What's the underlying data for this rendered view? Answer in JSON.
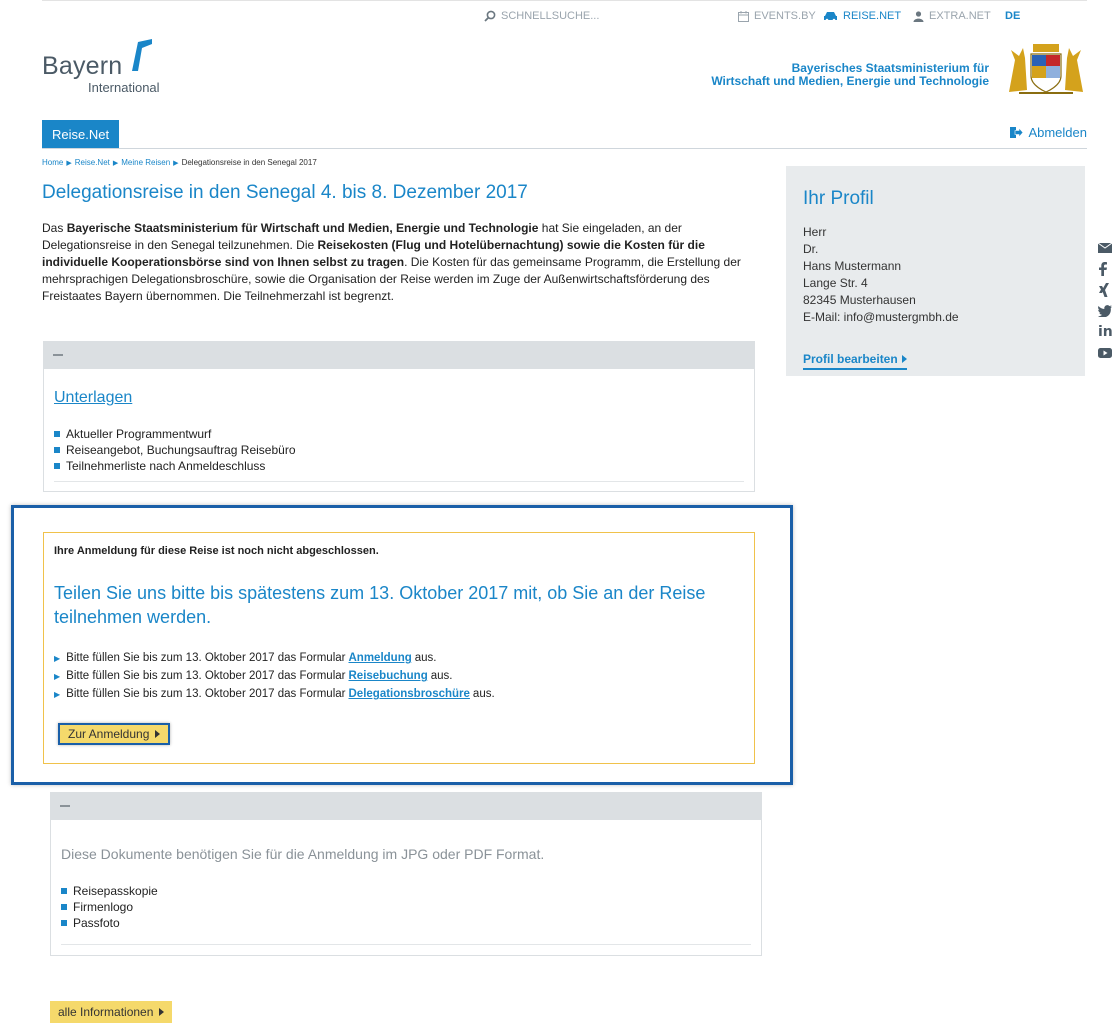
{
  "util": {
    "search_placeholder": "SCHNELLSUCHE...",
    "events": "EVENTS.BY",
    "reise": "REISE.NET",
    "extra": "EXTRA.NET",
    "lang": "DE"
  },
  "logo": {
    "line1": "Bayern",
    "line2": "International"
  },
  "ministry": {
    "line1": "Bayerisches Staatsministerium für",
    "line2": "Wirtschaft und Medien, Energie und Technologie"
  },
  "nav": {
    "tab": "Reise.Net",
    "logout": "Abmelden"
  },
  "breadcrumb": [
    "Home",
    "Reise.Net",
    "Meine Reisen",
    "Delegationsreise in den Senegal 2017"
  ],
  "page": {
    "title": "Delegationsreise in den Senegal 4. bis 8. Dezember 2017",
    "intro": {
      "p1": "Das ",
      "b1": "Bayerische Staatsministerium für Wirtschaft und Medien, Energie und Technologie",
      "p2": " hat Sie eingeladen, an der Delegationsreise in den Senegal teilzunehmen. Die ",
      "b2": "Reisekosten (Flug und Hotelübernachtung) sowie die Kosten für die individuelle Kooperationsbörse sind von Ihnen selbst zu tragen",
      "p3": ". Die Kosten für das gemeinsame Programm, die Erstellung der mehrsprachigen Delegationsbroschüre, sowie die Organisation der Reise werden im Zuge der Außenwirtschaftsförderung des Freistaates Bayern übernommen. Die Teilnehmerzahl ist begrenzt."
    }
  },
  "unterlagen": {
    "title": "Unterlagen",
    "items": [
      "Aktueller Programmentwurf",
      "Reiseangebot, Buchungsauftrag Reisebüro",
      "Teilnehmerliste nach Anmeldeschluss"
    ]
  },
  "registration": {
    "notice": "Ihre Anmeldung für diese Reise ist noch nicht abgeschlossen.",
    "headline": "Teilen Sie uns bitte bis spätestens zum 13. Oktober 2017 mit, ob Sie an der Reise teilnehmen werden.",
    "rows": [
      {
        "pre": "Bitte füllen Sie bis zum 13. Oktober 2017 das Formular",
        "link": "Anmeldung",
        "post": "aus."
      },
      {
        "pre": "Bitte füllen Sie bis zum 13. Oktober 2017 das Formular",
        "link": "Reisebuchung",
        "post": "aus."
      },
      {
        "pre": "Bitte füllen Sie bis zum 13. Oktober 2017 das Formular",
        "link": "Delegationsbroschüre",
        "post": "aus."
      }
    ],
    "button": "Zur Anmeldung"
  },
  "docs": {
    "text": "Diese Dokumente benötigen Sie für die Anmeldung im JPG oder PDF Format.",
    "items": [
      "Reisepasskopie",
      "Firmenlogo",
      "Passfoto"
    ]
  },
  "all_info_button": "alle Informationen",
  "profile": {
    "title": "Ihr Profil",
    "salutation": "Herr",
    "degree": "Dr.",
    "name": "Hans Mustermann",
    "street": "Lange Str. 4",
    "city": "82345 Musterhausen",
    "email": "E-Mail: info@mustergmbh.de",
    "edit": "Profil bearbeiten"
  },
  "social": [
    "mail-icon",
    "facebook-icon",
    "xing-icon",
    "twitter-icon",
    "linkedin-icon",
    "youtube-icon"
  ],
  "colors": {
    "accent": "#1a86c8",
    "highlight": "#1a5fa8",
    "button": "#f5d96b",
    "panel": "#dbdfe2"
  }
}
